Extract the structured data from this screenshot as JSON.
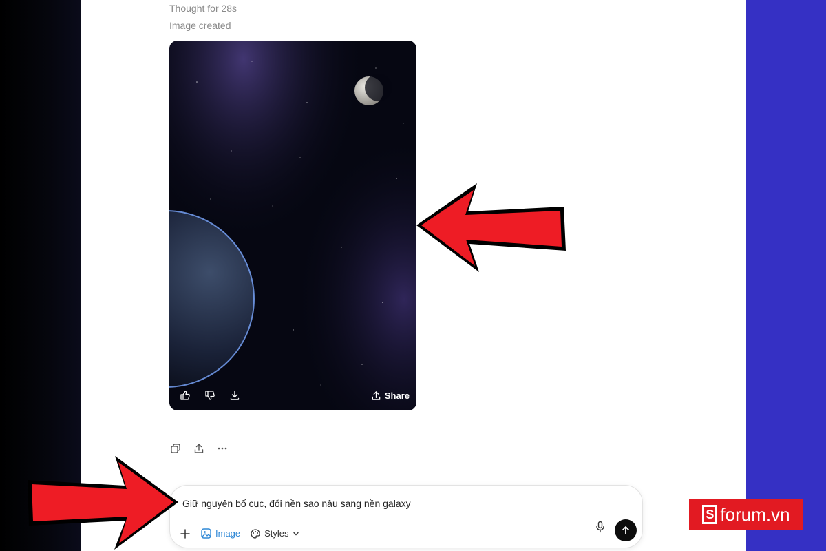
{
  "conversation": {
    "thought_status": "Thought for 28s",
    "image_status": "Image created"
  },
  "image_card": {
    "share_label": "Share",
    "actions": [
      "thumbs-up-icon",
      "thumbs-down-icon",
      "download-icon",
      "share-icon"
    ]
  },
  "message_actions": [
    "copy-icon",
    "share-icon",
    "more-icon"
  ],
  "composer": {
    "text": "Giữ nguyên bố cục, đổi nền sao nâu sang nền galaxy",
    "image_label": "Image",
    "styles_label": "Styles"
  },
  "watermark": {
    "brand": "forum.vn",
    "mark": "S"
  },
  "colors": {
    "accent_blue": "#2f88d6",
    "right_panel": "#3530c4",
    "arrow_red": "#ee1c25",
    "logo_red": "#e21a22"
  }
}
